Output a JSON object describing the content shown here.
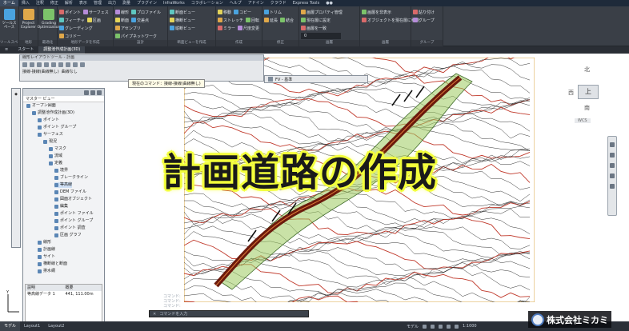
{
  "menu_tabs": [
    "ホーム",
    "挿入",
    "注釈",
    "修正",
    "解析",
    "表示",
    "管理",
    "出力",
    "測量",
    "プラグイン",
    "InfraWorks",
    "コラボレーション",
    "ヘルプ",
    "アドイン",
    "クラウド",
    "Express Tools",
    "●●"
  ],
  "ribbon": {
    "groups": [
      {
        "title": "ツールスペース",
        "buttons": [
          "ツールスペース"
        ],
        "big": true
      },
      {
        "title": "地形",
        "buttons": [
          "Project Explorer"
        ],
        "big": true
      },
      {
        "title": "最適化",
        "buttons": [
          "Grading Optimization"
        ],
        "big": true
      },
      {
        "title": "地形データを作成",
        "buttons": [
          "ポイント",
          "サーフェス",
          "フィーチャ",
          "区画",
          "グレーディング",
          "コリドー"
        ]
      },
      {
        "title": "設計",
        "buttons": [
          "線形",
          "プロファイル",
          "断面",
          "交差点",
          "アセンブリ",
          "パイプネットワーク"
        ]
      },
      {
        "title": "断面ビューを作成",
        "buttons": [
          "断面ビュー",
          "横断ビュー",
          "縦断ビュー"
        ]
      },
      {
        "title": "作成",
        "buttons": [
          "移動",
          "コピー",
          "ストレッチ",
          "回転",
          "ミラー",
          "尺度変更"
        ]
      },
      {
        "title": "修正",
        "buttons": [
          "トリム",
          "延長",
          "結合"
        ]
      },
      {
        "title": "画層",
        "buttons": [
          "画層プロパティ管理",
          "現在層に設定",
          "画層を一致"
        ]
      },
      {
        "title": "画層",
        "buttons": [
          "画層を非表示",
          "オブジェクトを現在層に移動"
        ]
      },
      {
        "title": "グループ",
        "buttons": [
          "貼り付け",
          "グループ"
        ]
      }
    ],
    "layer_value": "0"
  },
  "doc_tabs": [
    "スタート",
    "調整池作成計画(3D)"
  ],
  "float_toolbar": {
    "title": "線形レイアウトツール - 計画",
    "row1_label": "接線-接線(曲線無し)",
    "row2_label": "曲線なし"
  },
  "tooltip": "現在のコマンド：接線-接線(曲線無し)",
  "profile_toolbar_label": "FV - 基準",
  "toolspace": {
    "selector": "マスター ビュー",
    "items": [
      {
        "label": "オープン図面",
        "level": 0
      },
      {
        "label": "調整池作成計画(3D)",
        "level": 1
      },
      {
        "label": "ポイント",
        "level": 2
      },
      {
        "label": "ポイント グループ",
        "level": 2
      },
      {
        "label": "サーフェス",
        "level": 2
      },
      {
        "label": "現況",
        "level": 3
      },
      {
        "label": "マスク",
        "level": 4
      },
      {
        "label": "流域",
        "level": 4
      },
      {
        "label": "定義",
        "level": 4
      },
      {
        "label": "境界",
        "level": 5
      },
      {
        "label": "ブレークライン",
        "level": 5
      },
      {
        "label": "等高線",
        "level": 5,
        "selected": true
      },
      {
        "label": "DEM ファイル",
        "level": 5
      },
      {
        "label": "図面オブジェクト",
        "level": 5
      },
      {
        "label": "編集",
        "level": 5
      },
      {
        "label": "ポイント ファイル",
        "level": 5
      },
      {
        "label": "ポイント グループ",
        "level": 5
      },
      {
        "label": "ポイント 調査",
        "level": 5
      },
      {
        "label": "区画 グラフ",
        "level": 5
      },
      {
        "label": "線形",
        "level": 2
      },
      {
        "label": "計画線",
        "level": 2
      },
      {
        "label": "サイト",
        "level": 2
      },
      {
        "label": "横断線と断面",
        "level": 2
      },
      {
        "label": "排水網",
        "level": 2
      }
    ],
    "table_headers": [
      "説明",
      "概要"
    ],
    "table_rows": [
      [
        "等高線データ 1",
        "441, 111.00m"
      ]
    ]
  },
  "title_text": "計画道路の作成",
  "viewcube": {
    "north": "北",
    "west": "西",
    "face": "上",
    "south": "南",
    "wcs": "WCS"
  },
  "command_history": [
    "コマンド:",
    "コマンド:",
    "コマンド:"
  ],
  "command_placeholder": "コマンドを入力",
  "status_tabs": [
    "モデル",
    "Layout1",
    "Layout2"
  ],
  "status_right": {
    "model_label": "モデル",
    "scale": "1:1000"
  },
  "brand_name": "株式会社ミカミ",
  "colors": {
    "accent": "#f3ff3c",
    "road": "#6b1a0c",
    "road_fill": "#9ccb5e",
    "contour_red": "#c0392b",
    "contour_black": "#333333"
  }
}
